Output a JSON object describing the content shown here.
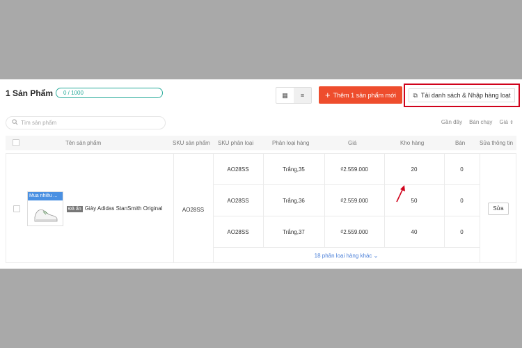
{
  "header": {
    "title": "1 Sản Phẩm",
    "quota": "0 / 1000",
    "add_button": "Thêm 1 sản phẩm mới",
    "add_icon": "+",
    "import_button": "Tải danh sách & Nhập hàng loạt",
    "grid_icon": "▦",
    "list_icon": "≡"
  },
  "search": {
    "placeholder": "Tìm sản phẩm"
  },
  "sort": {
    "recent": "Gần đây",
    "bestseller": "Bán chạy",
    "price": "Giá",
    "price_arrow": "⇕"
  },
  "columns": {
    "name": "Tên sản phẩm",
    "sku": "SKU sản phẩm",
    "variant_sku": "SKU phân loại",
    "variant": "Phân loại hàng",
    "price": "Giá",
    "stock": "Kho hàng",
    "sold": "Bán",
    "edit": "Sửa thông tin"
  },
  "product": {
    "badge": "Đã ẩn",
    "name": "Giày Adidas StanSmith Original",
    "image_tag": "Mua nhiều ...",
    "sku": "AO28SS",
    "edit_label": "Sửa",
    "variants": [
      {
        "sku": "AO28SS",
        "name": "Trắng,35",
        "price": "₫2.559.000",
        "stock": "20",
        "sold": "0"
      },
      {
        "sku": "AO28SS",
        "name": "Trắng,36",
        "price": "₫2.559.000",
        "stock": "50",
        "sold": "0"
      },
      {
        "sku": "AO28SS",
        "name": "Trắng,37",
        "price": "₫2.559.000",
        "stock": "40",
        "sold": "0"
      }
    ],
    "more_variants": "18 phân loại hàng khác",
    "more_arrow": "⌄"
  },
  "colors": {
    "accent": "#ee4d2d",
    "highlight": "#d0021b",
    "teal": "#26aa99",
    "link": "#4a7fd8"
  }
}
